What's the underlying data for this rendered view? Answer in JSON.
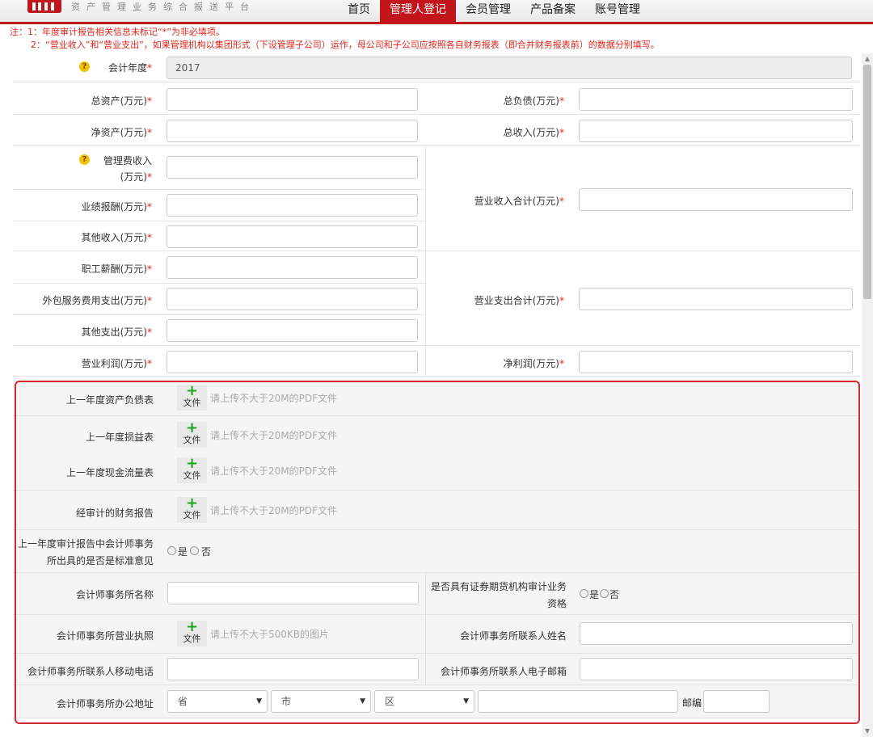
{
  "header": {
    "brand": "资产管理业务综合报送平台",
    "nav": [
      "首页",
      "管理人登记",
      "会员管理",
      "产品备案",
      "账号管理"
    ],
    "active_nav": "管理人登记"
  },
  "notes": {
    "line1": "注：1：年度审计报告相关信息未标记“*”为非必填项。",
    "line2": "2：“营业收入”和“营业支出”，如果管理机构以集团形式（下设管理子公司）运作，母公司和子公司应按照各自财务报表（即合并财务报表前）的数据分别填写。"
  },
  "form": {
    "year_label": "会计年度",
    "year_value": "2017",
    "total_assets": "总资产(万元)",
    "total_liabilities": "总负债(万元)",
    "net_assets": "净资产(万元)",
    "total_income": "总收入(万元)",
    "mgmt_fee_1": "管理费收入",
    "mgmt_fee_2": "(万元)",
    "performance_fee": "业绩报酬(万元)",
    "other_income": "其他收入(万元)",
    "op_income_total": "营业收入合计(万元)",
    "staff_pay": "职工薪酬(万元)",
    "outsourcing": "外包服务费用支出(万元)",
    "other_expense": "其他支出(万元)",
    "op_expense_total": "营业支出合计(万元)",
    "op_profit": "营业利润(万元)",
    "net_profit": "净利润(万元)",
    "req_mark": "*",
    "help_glyph": "?"
  },
  "uploads": {
    "btn_plus": "+",
    "btn_text": "文件",
    "balance_sheet": "上一年度资产负债表",
    "income_statement": "上一年度损益表",
    "cashflow": "上一年度现金流量表",
    "audited_report": "经审计的财务报告",
    "pdf_hint": "请上传不大于20M的PDF文件",
    "license_label": "会计师事务所营业执照",
    "img_hint": "请上传不大于500KB的图片"
  },
  "audit": {
    "opinion_q1": "上一年度审计报告中会计师事务",
    "opinion_q2": "所出具的是否是标准意见",
    "yes": "是",
    "no": "否",
    "firm_name": "会计师事务所名称",
    "securities_q1": "是否具有证券期货机构审计业务",
    "securities_q2": "资格",
    "contact_name": "会计师事务所联系人姓名",
    "contact_mobile": "会计师事务所联系人移动电话",
    "contact_email": "会计师事务所联系人电子邮箱",
    "office_address": "会计师事务所办公地址",
    "province": "省",
    "city": "市",
    "district": "区",
    "postcode": "邮编"
  }
}
